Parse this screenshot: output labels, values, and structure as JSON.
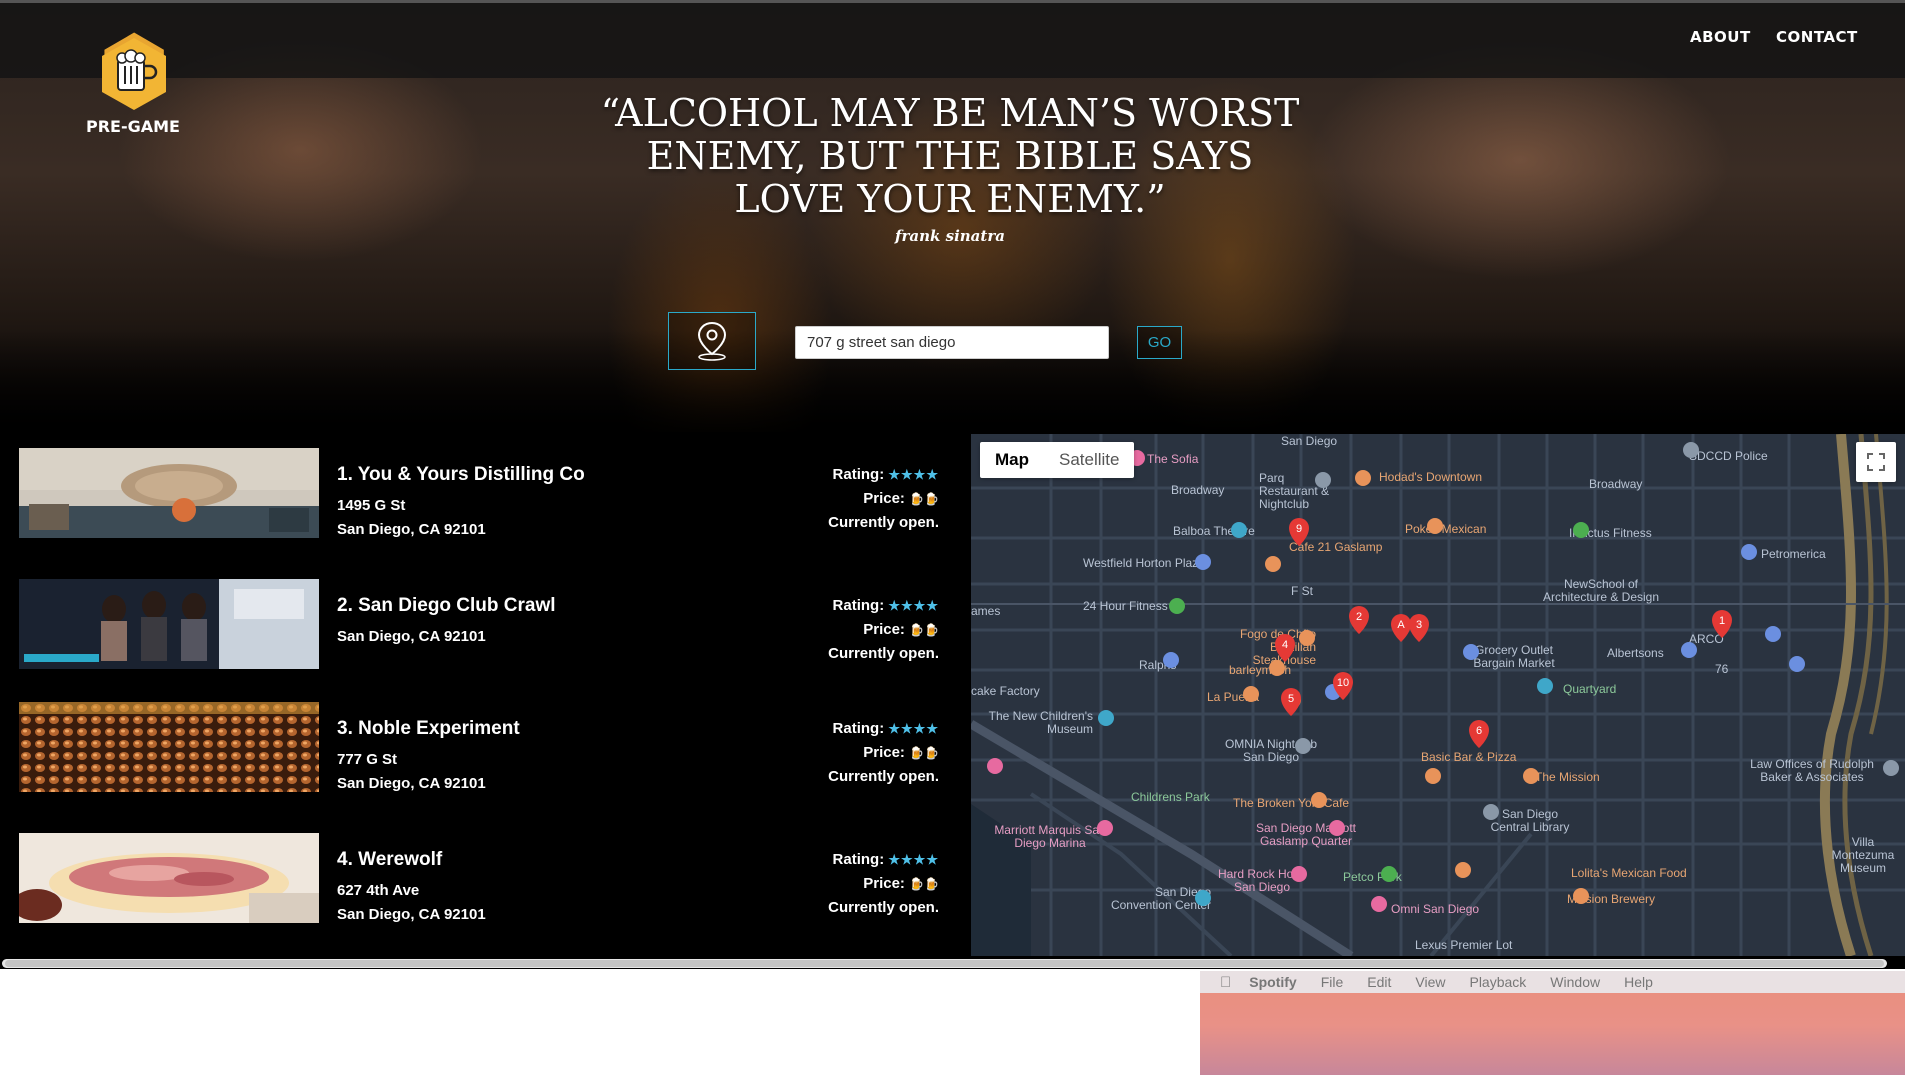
{
  "header": {
    "logo_text": "PRE-GAME",
    "nav": [
      {
        "label": "ABOUT"
      },
      {
        "label": "CONTACT"
      }
    ]
  },
  "hero": {
    "quote": "“ALCOHOL MAY BE MAN’S WORST ENEMY, BUT THE BIBLE SAYS LOVE YOUR ENEMY.”",
    "author": "frank sinatra"
  },
  "search": {
    "value": "707 g street san diego",
    "go_label": "GO"
  },
  "results": [
    {
      "name": "1. You & Yours Distilling Co",
      "address1": "1495 G St",
      "address2": "San Diego, CA 92101",
      "rating_label": "Rating:",
      "stars": "★★★★",
      "price_label": "Price:",
      "price": "🍺🍺",
      "status": "Currently open."
    },
    {
      "name": "2. San Diego Club Crawl",
      "address1": "",
      "address2": "San Diego, CA 92101",
      "rating_label": "Rating:",
      "stars": "★★★★",
      "price_label": "Price:",
      "price": "🍺🍺",
      "status": "Currently open."
    },
    {
      "name": "3. Noble Experiment",
      "address1": "777 G St",
      "address2": "San Diego, CA 92101",
      "rating_label": "Rating:",
      "stars": "★★★★",
      "price_label": "Price:",
      "price": "🍺🍺",
      "status": "Currently open."
    },
    {
      "name": "4. Werewolf",
      "address1": "627 4th Ave",
      "address2": "San Diego, CA 92101",
      "rating_label": "Rating:",
      "stars": "★★★★",
      "price_label": "Price:",
      "price": "🍺🍺",
      "status": "Currently open."
    }
  ],
  "map": {
    "tabs": [
      "Map",
      "Satellite"
    ],
    "labels": [
      "San Diego",
      "The Sofia",
      "SDCCD Police",
      "Parq Restaurant & Nightclub",
      "Hodad's Downtown",
      "Broadway",
      "Broadway",
      "Balboa Theatre",
      "Pokez Mexican",
      "Invictus Fitness",
      "Petromerica",
      "Westfield Horton Plaza",
      "Cafe 21 Gaslamp",
      "F St",
      "NewSchool of Architecture & Design",
      "24 Hour Fitness",
      "ARCO",
      "Fogo de Chão Brazilian Steakhouse",
      "Grocery Outlet Bargain Market",
      "Albertsons",
      "Ralphs",
      "barleymash",
      "76",
      "cake Factory",
      "La Puerta",
      "Quartyard",
      "The New Children's Museum",
      "OMNIA Nightclub San Diego",
      "Basic Bar & Pizza",
      "The Mission",
      "Law Offices of Rudolph Baker & Associates",
      "Childrens Park",
      "The Broken Yolk Cafe",
      "San Diego Central Library",
      "Marriott Marquis San Diego Marina",
      "San Diego Marriott Gaslamp Quarter",
      "Villa Montezuma Museum",
      "Hard Rock Hotel San Diego",
      "Petco Park",
      "Lolita's Mexican Food",
      "San Diego Convention Center",
      "Omni San Diego",
      "Mission Brewery",
      "Lexus Premier Lot",
      "ames"
    ],
    "markers": [
      "9",
      "2",
      "A",
      "3",
      "1",
      "4",
      "10",
      "5",
      "6"
    ]
  },
  "mac_menu": {
    "items": [
      "Spotify",
      "File",
      "Edit",
      "View",
      "Playback",
      "Window",
      "Help"
    ]
  }
}
